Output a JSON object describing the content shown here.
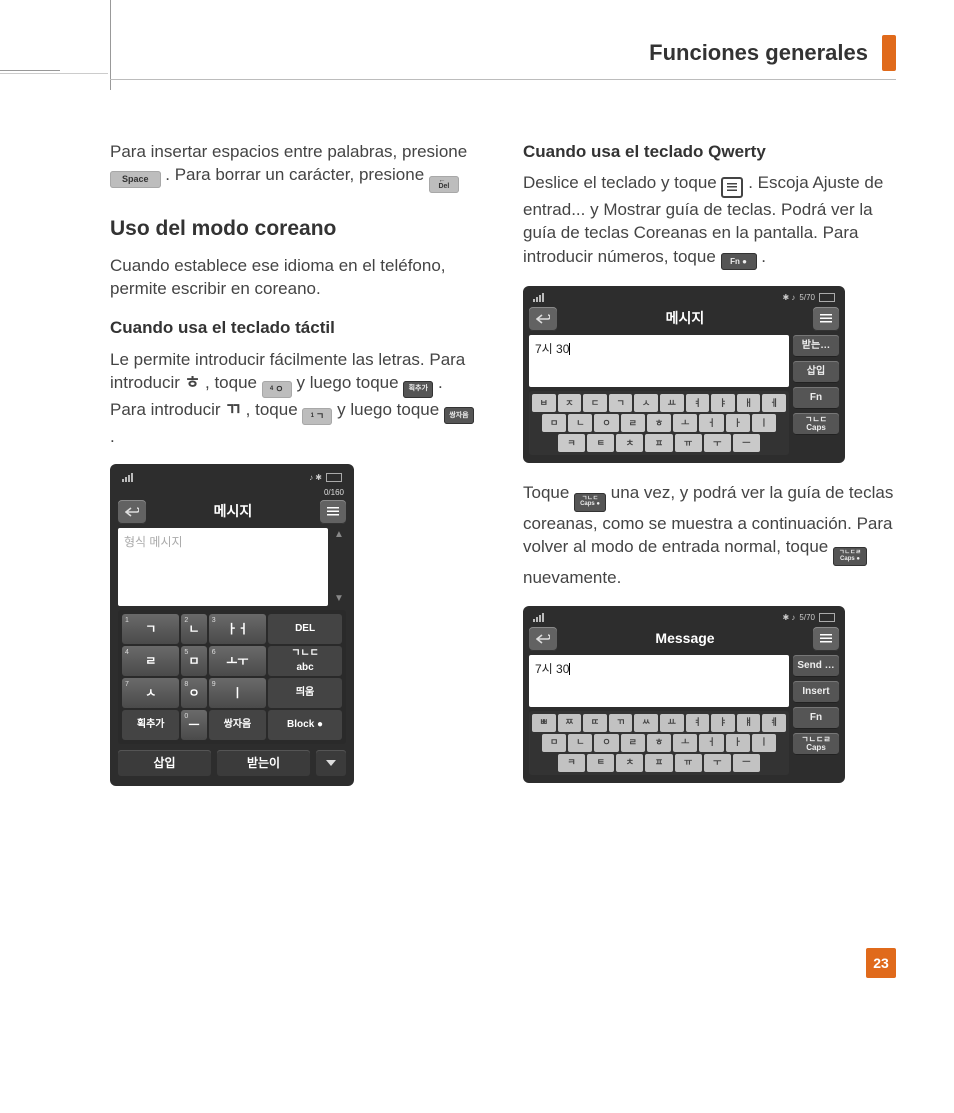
{
  "header": {
    "section_title": "Funciones generales"
  },
  "left": {
    "p1": {
      "a": "Para insertar espacios entre palabras, presione ",
      "space_key": "Space",
      "b": ". Para borrar un carácter, presione ",
      "del_key": "←\nDel"
    },
    "h2": "Uso del modo coreano",
    "p2": "Cuando establece ese idioma en el teléfono, permite escribir en coreano.",
    "h3": "Cuando usa el teclado táctil",
    "p3": {
      "a": "Le permite introducir fácilmente las letras. Para introducir ",
      "glyph1": "ㅎ",
      "b": ", toque ",
      "key1_sup": "4",
      "key1_g": "ㅇ",
      "c": " y luego toque ",
      "key2": "획추가",
      "d": ". Para introducir ",
      "glyph2": "ㄲ",
      "e": ", toque ",
      "key3_sup": "1",
      "key3_g": "ㄱ",
      "f": " y luego toque ",
      "key4": "쌍자음",
      "g": "."
    },
    "phone1": {
      "counter": "0/160",
      "title": "메시지",
      "placeholder": "형식 메시지",
      "keys": {
        "r1": [
          {
            "sup": "1",
            "g": "ㄱ"
          },
          {
            "sup": "2",
            "g": "ㄴ"
          },
          {
            "sup": "3",
            "g": "ㅏㅓ"
          },
          {
            "label": "DEL",
            "spec": true
          }
        ],
        "r2": [
          {
            "sup": "4",
            "g": "ㄹ"
          },
          {
            "sup": "5",
            "g": "ㅁ"
          },
          {
            "sup": "6",
            "g": "ㅗㅜ"
          },
          {
            "label": "ㄱㄴㄷ\nabc",
            "spec": true,
            "abc": true
          }
        ],
        "r3": [
          {
            "sup": "7",
            "g": "ㅅ"
          },
          {
            "sup": "8",
            "g": "ㅇ"
          },
          {
            "sup": "9",
            "g": "ㅣ"
          },
          {
            "label": "띄움",
            "spec": true
          }
        ],
        "r4": [
          {
            "label": "획추가",
            "spec": true
          },
          {
            "sup": "0",
            "g": "ㅡ"
          },
          {
            "label": "쌍자음",
            "spec": true
          },
          {
            "label": "Block ●",
            "spec": true
          }
        ]
      },
      "footer": {
        "left": "삽입",
        "right": "받는이"
      }
    }
  },
  "right": {
    "h3": "Cuando usa el teclado Qwerty",
    "p1": {
      "a": "Deslice el teclado y toque ",
      "b": ". Escoja Ajuste de entrad... y Mostrar guía de teclas. Podrá ver la guía de teclas Coreanas en la pantalla. Para introducir números, toque ",
      "fn_key": "Fn   ●",
      "c": "."
    },
    "phone2": {
      "counter": "5/70",
      "title": "메시지",
      "typed": "7시 30",
      "side": [
        "받는…",
        "삽입",
        "Fn",
        "ㄱㄴㄷ\nCaps"
      ],
      "rows": [
        [
          "ㅂ",
          "ㅈ",
          "ㄷ",
          "ㄱ",
          "ㅅ",
          "ㅛ",
          "ㅕ",
          "ㅑ",
          "ㅐ",
          "ㅔ"
        ],
        [
          "ㅁ",
          "ㄴ",
          "ㅇ",
          "ㄹ",
          "ㅎ",
          "ㅗ",
          "ㅓ",
          "ㅏ",
          "ㅣ"
        ],
        [
          "ㅋ",
          "ㅌ",
          "ㅊ",
          "ㅍ",
          "ㅠ",
          "ㅜ",
          "ㅡ"
        ]
      ]
    },
    "p2": {
      "a": "Toque ",
      "caps_key": "ㄱㄴㄷ\nCaps ●",
      "b": " una vez, y podrá ver la guía de teclas coreanas, como se muestra a continuación. Para volver al modo de entrada normal, toque ",
      "caps_key2": "ㄱㄴㄷㄹ\nCaps ●",
      "c": " nuevamente."
    },
    "phone3": {
      "counter": "5/70",
      "title": "Message",
      "typed": "7시 30",
      "side": [
        "Send …",
        "Insert",
        "Fn",
        "ㄱㄴㄷㄹ\nCaps"
      ],
      "rows": [
        [
          "ㅃ",
          "ㅉ",
          "ㄸ",
          "ㄲ",
          "ㅆ",
          "ㅛ",
          "ㅕ",
          "ㅑ",
          "ㅒ",
          "ㅖ"
        ],
        [
          "ㅁ",
          "ㄴ",
          "ㅇ",
          "ㄹ",
          "ㅎ",
          "ㅗ",
          "ㅓ",
          "ㅏ",
          "ㅣ"
        ],
        [
          "ㅋ",
          "ㅌ",
          "ㅊ",
          "ㅍ",
          "ㅠ",
          "ㅜ",
          "ㅡ"
        ]
      ]
    }
  },
  "page_number": "23"
}
